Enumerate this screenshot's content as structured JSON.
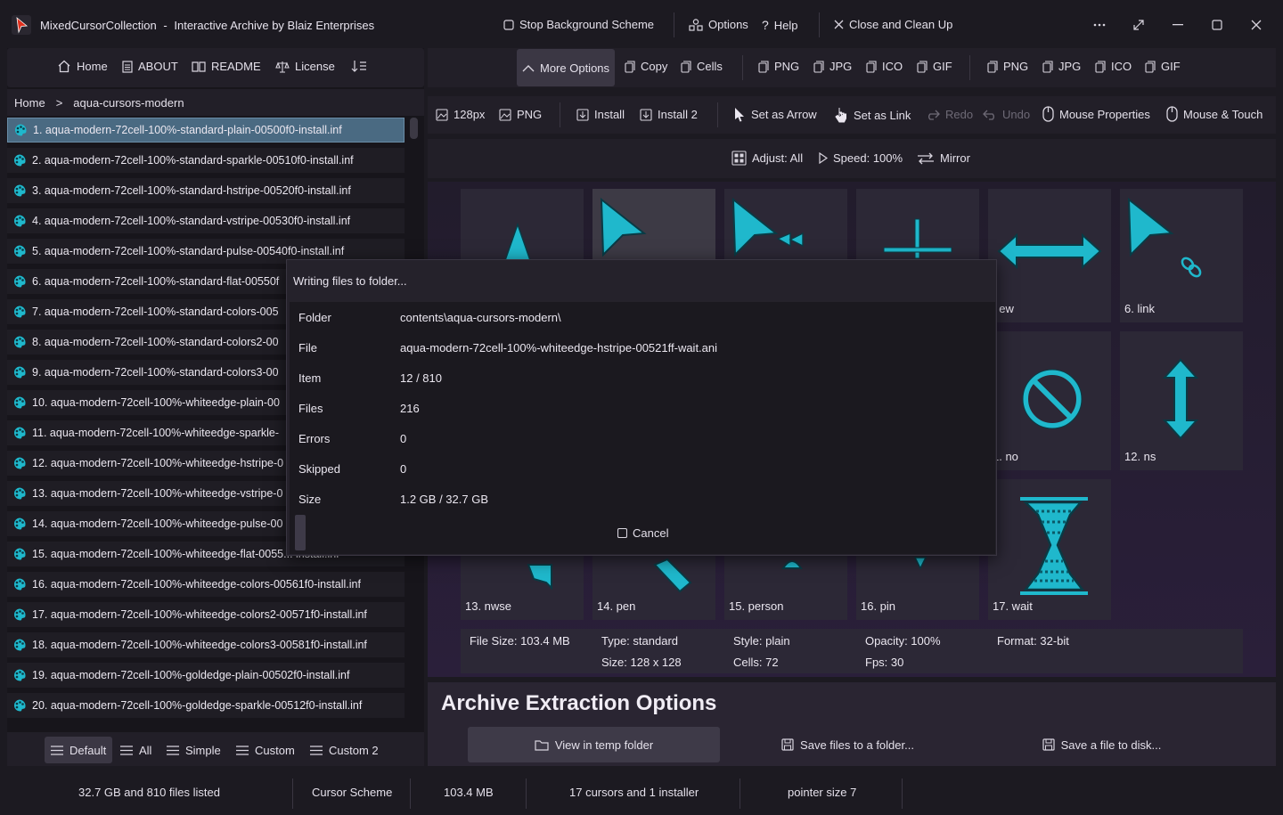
{
  "window": {
    "app_name": "MixedCursorCollection",
    "separator": "-",
    "subtitle": "Interactive Archive by Blaiz Enterprises",
    "stop_bg": "Stop Background Scheme",
    "options": "Options",
    "help": "Help",
    "close_cleanup": "Close and Clean Up"
  },
  "left_nav": {
    "home": "Home",
    "about": "ABOUT",
    "readme": "README",
    "license": "License"
  },
  "breadcrumb": {
    "root": "Home",
    "sep": ">",
    "current": "aqua-cursors-modern"
  },
  "files": [
    {
      "label": "1.  aqua-modern-72cell-100%-standard-plain-00500f0-install.inf"
    },
    {
      "label": "2.  aqua-modern-72cell-100%-standard-sparkle-00510f0-install.inf"
    },
    {
      "label": "3.  aqua-modern-72cell-100%-standard-hstripe-00520f0-install.inf"
    },
    {
      "label": "4.  aqua-modern-72cell-100%-standard-vstripe-00530f0-install.inf"
    },
    {
      "label": "5.  aqua-modern-72cell-100%-standard-pulse-00540f0-install.inf"
    },
    {
      "label": "6.  aqua-modern-72cell-100%-standard-flat-00550f"
    },
    {
      "label": "7.  aqua-modern-72cell-100%-standard-colors-005"
    },
    {
      "label": "8.  aqua-modern-72cell-100%-standard-colors2-00"
    },
    {
      "label": "9.  aqua-modern-72cell-100%-standard-colors3-00"
    },
    {
      "label": "10.  aqua-modern-72cell-100%-whiteedge-plain-00"
    },
    {
      "label": "11.  aqua-modern-72cell-100%-whiteedge-sparkle-"
    },
    {
      "label": "12.  aqua-modern-72cell-100%-whiteedge-hstripe-0"
    },
    {
      "label": "13.  aqua-modern-72cell-100%-whiteedge-vstripe-0"
    },
    {
      "label": "14.  aqua-modern-72cell-100%-whiteedge-pulse-00"
    },
    {
      "label": "15.  aqua-modern-72cell-100%-whiteedge-flat-0055... install.inf"
    },
    {
      "label": "16.  aqua-modern-72cell-100%-whiteedge-colors-00561f0-install.inf"
    },
    {
      "label": "17.  aqua-modern-72cell-100%-whiteedge-colors2-00571f0-install.inf"
    },
    {
      "label": "18.  aqua-modern-72cell-100%-whiteedge-colors3-00581f0-install.inf"
    },
    {
      "label": "19.  aqua-modern-72cell-100%-goldedge-plain-00502f0-install.inf"
    },
    {
      "label": "20.  aqua-modern-72cell-100%-goldedge-sparkle-00512f0-install.inf"
    }
  ],
  "left_footer": {
    "default": "Default",
    "all": "All",
    "simple": "Simple",
    "custom": "Custom",
    "custom2": "Custom 2"
  },
  "toolbar1": {
    "more_options": "More Options",
    "copy": "Copy",
    "cells": "Cells",
    "png": "PNG",
    "jpg": "JPG",
    "ico": "ICO",
    "gif": "GIF",
    "png2": "PNG",
    "jpg2": "JPG",
    "ico2": "ICO",
    "gif2": "GIF"
  },
  "toolbar2": {
    "size": "128px",
    "png": "PNG",
    "install": "Install",
    "install2": "Install 2",
    "set_arrow": "Set as Arrow",
    "set_link": "Set as Link",
    "redo": "Redo",
    "undo": "Undo",
    "mouse_props": "Mouse Properties",
    "mouse_touch": "Mouse & Touch"
  },
  "toolbar3": {
    "adjust": "Adjust: All",
    "speed": "Speed: 100%",
    "mirror": "Mirror"
  },
  "cursors": [
    {
      "caption": "",
      "icon": "up-arrow-icon"
    },
    {
      "caption": "",
      "icon": "arrow-icon"
    },
    {
      "caption": "",
      "icon": "arrow-bow-icon"
    },
    {
      "caption": "",
      "icon": "cross-icon"
    },
    {
      "caption": ". ew",
      "icon": "resize-ew-icon"
    },
    {
      "caption": "6. link",
      "icon": "link-icon"
    },
    {
      "caption": "1. no",
      "icon": "no-icon"
    },
    {
      "caption": "12. ns",
      "icon": "resize-ns-icon"
    },
    {
      "caption": "13. nwse",
      "icon": "resize-nwse-icon"
    },
    {
      "caption": "14. pen",
      "icon": "pen-icon"
    },
    {
      "caption": "15. person",
      "icon": "person-icon"
    },
    {
      "caption": "16. pin",
      "icon": "pin-icon"
    },
    {
      "caption": "17. wait",
      "icon": "hourglass-icon"
    }
  ],
  "info": {
    "file_size": "File Size: 103.4 MB",
    "type": "Type: standard",
    "size": "Size: 128 x 128",
    "style": "Style: plain",
    "cells": "Cells: 72",
    "opacity": "Opacity: 100%",
    "fps": "Fps: 30",
    "format": "Format: 32-bit"
  },
  "archive": {
    "title": "Archive Extraction Options",
    "view_temp": "View in temp folder",
    "save_folder": "Save files to a folder...",
    "save_disk": "Save a file to disk..."
  },
  "status": {
    "listed": "32.7 GB and 810 files listed",
    "scheme": "Cursor Scheme",
    "size": "103.4 MB",
    "cursors": "17 cursors and 1 installer",
    "pointer": "pointer size 7"
  },
  "dialog": {
    "title": "Writing files to folder...",
    "rows": [
      {
        "label": "Folder",
        "value": "contents\\aqua-cursors-modern\\"
      },
      {
        "label": "File",
        "value": "aqua-modern-72cell-100%-whiteedge-hstripe-00521ff-wait.ani"
      },
      {
        "label": "Item",
        "value": "12 / 810"
      },
      {
        "label": "Files",
        "value": "216"
      },
      {
        "label": "Errors",
        "value": "0"
      },
      {
        "label": "Skipped",
        "value": "0"
      },
      {
        "label": "Size",
        "value": "1.2 GB / 32.7 GB"
      }
    ],
    "cancel": "Cancel"
  },
  "colors": {
    "accent": "#1fb8cc",
    "selection": "#4a6a82",
    "background": "#1c1a21"
  }
}
